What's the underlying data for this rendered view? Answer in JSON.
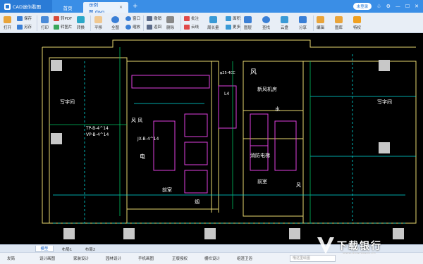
{
  "titlebar": {
    "app_name": "CAD迷你看图",
    "home_tab": "首页",
    "doc_tab": "示例图.dwg",
    "login_label": "未登录"
  },
  "toolbar": {
    "open": "打开",
    "save": "保存",
    "save_as": "另存",
    "print": "打印",
    "to_pdf": "转PDF",
    "to_image": "转图片",
    "convert": "转换",
    "pan": "平移",
    "full": "全图",
    "window": "窗口",
    "zoom": "缩放",
    "undo": "撤销",
    "back": "返回",
    "delete": "删除",
    "annotate": "批注",
    "cloud_line": "云线",
    "area": "面积",
    "length": "周长量",
    "more": "更多",
    "layers": "图层",
    "find": "查找",
    "cloud": "云盘",
    "share": "分享",
    "edit": "编辑",
    "gallery": "图库",
    "vip": "特权"
  },
  "drawing": {
    "labels": [
      "写字间",
      "写字间",
      "风",
      "新风机房",
      "水",
      "电",
      "风 风",
      "前室",
      "前室",
      "消防电梯",
      "烟",
      "L4",
      "JX-B-4^14",
      "TP-B-4^14",
      "VP-B-4^14",
      "φ25-4CC",
      "风"
    ]
  },
  "layout_tabs": [
    "模型",
    "布局1",
    "布局2"
  ],
  "bottom": {
    "items": [
      "发简",
      "设计画图",
      "家装设计",
      "园林设计",
      "手机画图",
      "正版授权",
      "栅栏设计",
      "组渣卫浴"
    ],
    "command_placeholder": "哦这里绘图",
    "watermark": "下载银行",
    "watermark_url": "www.downbank.cn"
  },
  "colors": {
    "titlebar": "#3a8ee6",
    "canvas": "#000000",
    "wall_yellow": "#e8d870",
    "line_cyan": "#00e0e0",
    "line_magenta": "#e040e0",
    "line_green": "#00c060",
    "text_white": "#ffffff"
  }
}
